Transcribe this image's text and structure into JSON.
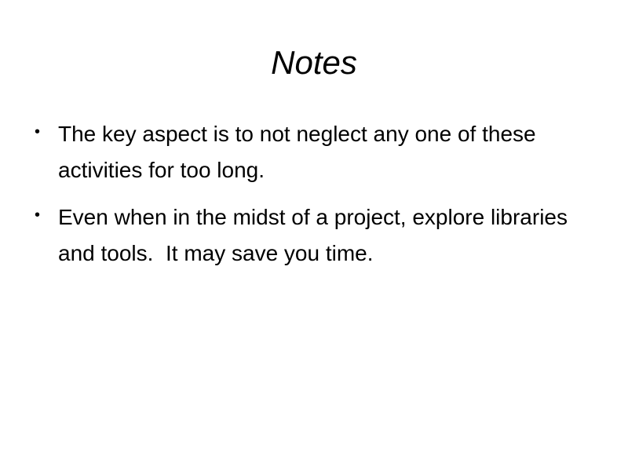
{
  "slide": {
    "title": "Notes",
    "bullets": [
      "The key aspect is to not neglect any one of these activities for too long.",
      "Even when in the midst of a project, explore libraries and tools.  It may save you time."
    ]
  }
}
